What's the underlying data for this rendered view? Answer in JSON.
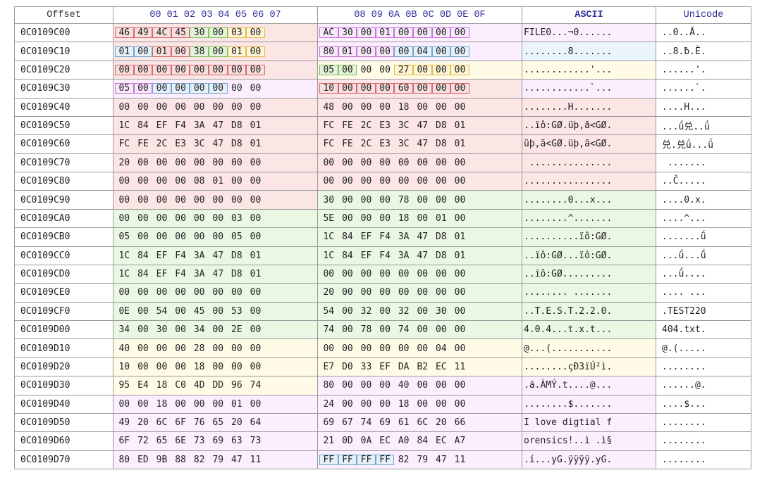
{
  "headers": {
    "offset": "Offset",
    "hex_left": "00 01 02 03 04 05 06 07",
    "hex_right": "08 09 0A 0B 0C 0D 0E 0F",
    "ascii": "ASCII",
    "unicode": "Unicode"
  },
  "colors": {
    "red": "#fbe5e5",
    "green": "#eaf7e3",
    "yellow": "#fffbe7",
    "purple": "#fbeeff",
    "blue": "#e9f4fb",
    "selection": "#b9c4ea"
  },
  "rows": [
    {
      "offset": "0C0109C00",
      "left": [
        "46",
        "49",
        "4C",
        "45",
        "30",
        "00",
        "03",
        "00"
      ],
      "right": [
        "AC",
        "30",
        "00",
        "01",
        "00",
        "00",
        "00",
        "00"
      ],
      "ascii": "FILE0...¬0......",
      "unicode": "..0..Ā.."
    },
    {
      "offset": "0C0109C10",
      "left": [
        "01",
        "00",
        "01",
        "00",
        "38",
        "00",
        "01",
        "00"
      ],
      "right": [
        "80",
        "01",
        "00",
        "00",
        "00",
        "04",
        "00",
        "00"
      ],
      "ascii": "........8.......",
      "unicode": "..8.ƀ.Ѐ."
    },
    {
      "offset": "0C0109C20",
      "left": [
        "00",
        "00",
        "00",
        "00",
        "00",
        "00",
        "00",
        "00"
      ],
      "right": [
        "05",
        "00",
        "00",
        "00",
        "27",
        "00",
        "00",
        "00"
      ],
      "ascii": "............'...",
      "unicode": "......'."
    },
    {
      "offset": "0C0109C30",
      "left": [
        "05",
        "00",
        "00",
        "00",
        "00",
        "00",
        "00",
        "00"
      ],
      "right": [
        "10",
        "00",
        "00",
        "00",
        "60",
        "00",
        "00",
        "00"
      ],
      "ascii": "............`...",
      "unicode": "......`."
    },
    {
      "offset": "0C0109C40",
      "left": [
        "00",
        "00",
        "00",
        "00",
        "00",
        "00",
        "00",
        "00"
      ],
      "right": [
        "48",
        "00",
        "00",
        "00",
        "18",
        "00",
        "00",
        "00"
      ],
      "ascii": "........H.......",
      "unicode": "....H..."
    },
    {
      "offset": "0C0109C50",
      "left": [
        "1C",
        "84",
        "EF",
        "F4",
        "3A",
        "47",
        "D8",
        "01"
      ],
      "right": [
        "FC",
        "FE",
        "2C",
        "E3",
        "3C",
        "47",
        "D8",
        "01"
      ],
      "ascii": "..ïô:GØ.üþ,ã<GØ.",
      "unicode": "...ǘ兑..ǘ"
    },
    {
      "offset": "0C0109C60",
      "left": [
        "FC",
        "FE",
        "2C",
        "E3",
        "3C",
        "47",
        "D8",
        "01"
      ],
      "right": [
        "FC",
        "FE",
        "2C",
        "E3",
        "3C",
        "47",
        "D8",
        "01"
      ],
      "ascii": "üþ,ã<GØ.üþ,ã<GØ.",
      "unicode": "兑.兑ǘ...ǘ"
    },
    {
      "offset": "0C0109C70",
      "left": [
        "20",
        "00",
        "00",
        "00",
        "00",
        "00",
        "00",
        "00"
      ],
      "right": [
        "00",
        "00",
        "00",
        "00",
        "00",
        "00",
        "00",
        "00"
      ],
      "ascii": " ...............",
      "unicode": " ......."
    },
    {
      "offset": "0C0109C80",
      "left": [
        "00",
        "00",
        "00",
        "00",
        "08",
        "01",
        "00",
        "00"
      ],
      "right": [
        "00",
        "00",
        "00",
        "00",
        "00",
        "00",
        "00",
        "00"
      ],
      "ascii": "................",
      "unicode": "..Ĉ....."
    },
    {
      "offset": "0C0109C90",
      "left": [
        "00",
        "00",
        "00",
        "00",
        "00",
        "00",
        "00",
        "00"
      ],
      "right": [
        "30",
        "00",
        "00",
        "00",
        "78",
        "00",
        "00",
        "00"
      ],
      "ascii": "........0...x...",
      "unicode": "....0.x."
    },
    {
      "offset": "0C0109CA0",
      "left": [
        "00",
        "00",
        "00",
        "00",
        "00",
        "00",
        "03",
        "00"
      ],
      "right": [
        "5E",
        "00",
        "00",
        "00",
        "18",
        "00",
        "01",
        "00"
      ],
      "ascii": "........^.......",
      "unicode": "....^..."
    },
    {
      "offset": "0C0109CB0",
      "left": [
        "05",
        "00",
        "00",
        "00",
        "00",
        "00",
        "05",
        "00"
      ],
      "right": [
        "1C",
        "84",
        "EF",
        "F4",
        "3A",
        "47",
        "D8",
        "01"
      ],
      "ascii": "..........ïô:GØ.",
      "unicode": ".......ǘ"
    },
    {
      "offset": "0C0109CC0",
      "left": [
        "1C",
        "84",
        "EF",
        "F4",
        "3A",
        "47",
        "D8",
        "01"
      ],
      "right": [
        "1C",
        "84",
        "EF",
        "F4",
        "3A",
        "47",
        "D8",
        "01"
      ],
      "ascii": "..ïô:GØ...ïô:GØ.",
      "unicode": "...ǘ...ǘ"
    },
    {
      "offset": "0C0109CD0",
      "left": [
        "1C",
        "84",
        "EF",
        "F4",
        "3A",
        "47",
        "D8",
        "01"
      ],
      "right": [
        "00",
        "00",
        "00",
        "00",
        "00",
        "00",
        "00",
        "00"
      ],
      "ascii": "..ïô:GØ.........",
      "unicode": "...ǘ...."
    },
    {
      "offset": "0C0109CE0",
      "left": [
        "00",
        "00",
        "00",
        "00",
        "00",
        "00",
        "00",
        "00"
      ],
      "right": [
        "20",
        "00",
        "00",
        "00",
        "00",
        "00",
        "00",
        "00"
      ],
      "ascii": "........ .......",
      "unicode": ".... ..."
    },
    {
      "offset": "0C0109CF0",
      "left": [
        "0E",
        "00",
        "54",
        "00",
        "45",
        "00",
        "53",
        "00"
      ],
      "right": [
        "54",
        "00",
        "32",
        "00",
        "32",
        "00",
        "30",
        "00"
      ],
      "ascii": "..T.E.S.T.2.2.0.",
      "unicode": ".TEST220"
    },
    {
      "offset": "0C0109D00",
      "left": [
        "34",
        "00",
        "30",
        "00",
        "34",
        "00",
        "2E",
        "00"
      ],
      "right": [
        "74",
        "00",
        "78",
        "00",
        "74",
        "00",
        "00",
        "00"
      ],
      "ascii": "4.0.4...t.x.t...",
      "unicode": "404.txt."
    },
    {
      "offset": "0C0109D10",
      "left": [
        "40",
        "00",
        "00",
        "00",
        "28",
        "00",
        "00",
        "00"
      ],
      "right": [
        "00",
        "00",
        "00",
        "00",
        "00",
        "00",
        "04",
        "00"
      ],
      "ascii": "@...(...........",
      "unicode": "@.(....."
    },
    {
      "offset": "0C0109D20",
      "left": [
        "10",
        "00",
        "00",
        "00",
        "18",
        "00",
        "00",
        "00"
      ],
      "right": [
        "E7",
        "D0",
        "33",
        "EF",
        "DA",
        "B2",
        "EC",
        "11"
      ],
      "ascii": "........çÐ3ïÚ²ì.",
      "unicode": "........"
    },
    {
      "offset": "0C0109D30",
      "left": [
        "95",
        "E4",
        "18",
        "C0",
        "4D",
        "DD",
        "96",
        "74"
      ],
      "right": [
        "80",
        "00",
        "00",
        "00",
        "40",
        "00",
        "00",
        "00"
      ],
      "ascii": ".ä.ÀMÝ.t....@...",
      "unicode": "......@."
    },
    {
      "offset": "0C0109D40",
      "left": [
        "00",
        "00",
        "18",
        "00",
        "00",
        "00",
        "01",
        "00"
      ],
      "right": [
        "24",
        "00",
        "00",
        "00",
        "18",
        "00",
        "00",
        "00"
      ],
      "ascii": "........$.......",
      "unicode": "....$..."
    },
    {
      "offset": "0C0109D50",
      "left": [
        "49",
        "20",
        "6C",
        "6F",
        "76",
        "65",
        "20",
        "64"
      ],
      "right": [
        "69",
        "67",
        "74",
        "69",
        "61",
        "6C",
        "20",
        "66"
      ],
      "ascii": "I love digtial f",
      "unicode": "........"
    },
    {
      "offset": "0C0109D60",
      "left": [
        "6F",
        "72",
        "65",
        "6E",
        "73",
        "69",
        "63",
        "73"
      ],
      "right": [
        "21",
        "0D",
        "0A",
        "EC",
        "A0",
        "84",
        "EC",
        "A7"
      ],
      "ascii": "orensics!..ì .ì§",
      "unicode": "........"
    },
    {
      "offset": "0C0109D70",
      "left": [
        "80",
        "ED",
        "9B",
        "88",
        "82",
        "79",
        "47",
        "11"
      ],
      "right": [
        "FF",
        "FF",
        "FF",
        "FF",
        "82",
        "79",
        "47",
        "11"
      ],
      "ascii": ".í...yG.ÿÿÿÿ.yG.",
      "unicode": "........"
    }
  ]
}
